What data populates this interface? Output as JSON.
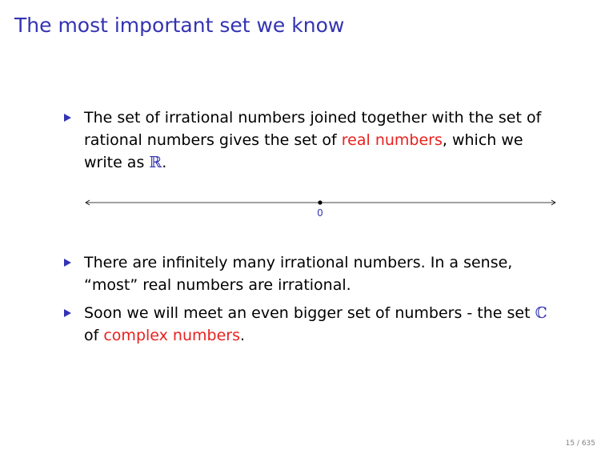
{
  "slide": {
    "title": "The most important set we know",
    "bullets": [
      {
        "t1": "The set of irrational numbers joined together with the set of",
        "t2": "rational numbers gives the set of ",
        "red": "real numbers",
        "t3": ", which we",
        "t4": "write as ",
        "symbol": "ℝ",
        "t5": "."
      },
      {
        "t1": "There are infinitely many irrational numbers.  In a sense,",
        "t2": "“most”  real numbers are irrational."
      },
      {
        "t1": "Soon we will meet an even bigger set of numbers - the set ",
        "symbol": "ℂ",
        "t2": "of ",
        "red": "complex numbers",
        "t3": "."
      }
    ],
    "number_line": {
      "zero_label": "0"
    },
    "page_number": "15 / 635"
  },
  "colors": {
    "title": "#3333b3",
    "highlight": "#e8211e",
    "bullet": "#3333b3"
  },
  "icons": {
    "bullet": "triangle-bullet-icon",
    "line_ends": "arrowhead-icon"
  }
}
